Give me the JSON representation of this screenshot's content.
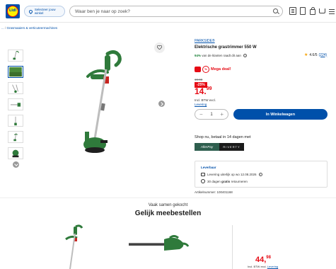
{
  "header": {
    "logo_text": "Lidl",
    "store_button": "Selecteer jouw winkel",
    "search_placeholder": "Waar ben je naar op zoek?"
  },
  "breadcrumb": [
    "...",
    "Grasmaaiers & verticuteermachines"
  ],
  "product": {
    "brand": "PARKSIDE®",
    "title": "Elektrische grastrimmer 550 W",
    "recommend_pct": "94%",
    "recommend_text": "van de klanten raadt dit aan",
    "rating": "4.6/5",
    "rating_count": "(224)",
    "mega_label": "Mega deal!",
    "old_price": "19.99",
    "discount": "-25%",
    "price_main": "14.",
    "price_cents": "99",
    "vat": "Incl. BTW excl.",
    "delivery_link": "Levering",
    "quantity": "1",
    "cart_button": "In Winkelwagen",
    "paylater": "Shop nu, betaal in 14 dagen met",
    "riverty_a": "AfterPay",
    "riverty_b": "RIVERTY",
    "availability": "Leverbaar",
    "delivery_line": "Levering uiterlijk op wo 12.08.2026",
    "returns_line_pre": "30 dagen",
    "returns_line_bold": "gratis",
    "returns_line_post": "retourneren",
    "article": "Artikelnummer: 100401168"
  },
  "together": {
    "subtitle": "Vaak samen gekocht",
    "title": "Gelijk meebestellen",
    "price_main": "44,",
    "price_cents": "98",
    "vat_text": "Incl. BTW excl.",
    "vat_link": "Levering"
  },
  "colors": {
    "brand_blue": "#0050aa",
    "deal_red": "#e60a14",
    "product_green": "#2f7a3b"
  }
}
